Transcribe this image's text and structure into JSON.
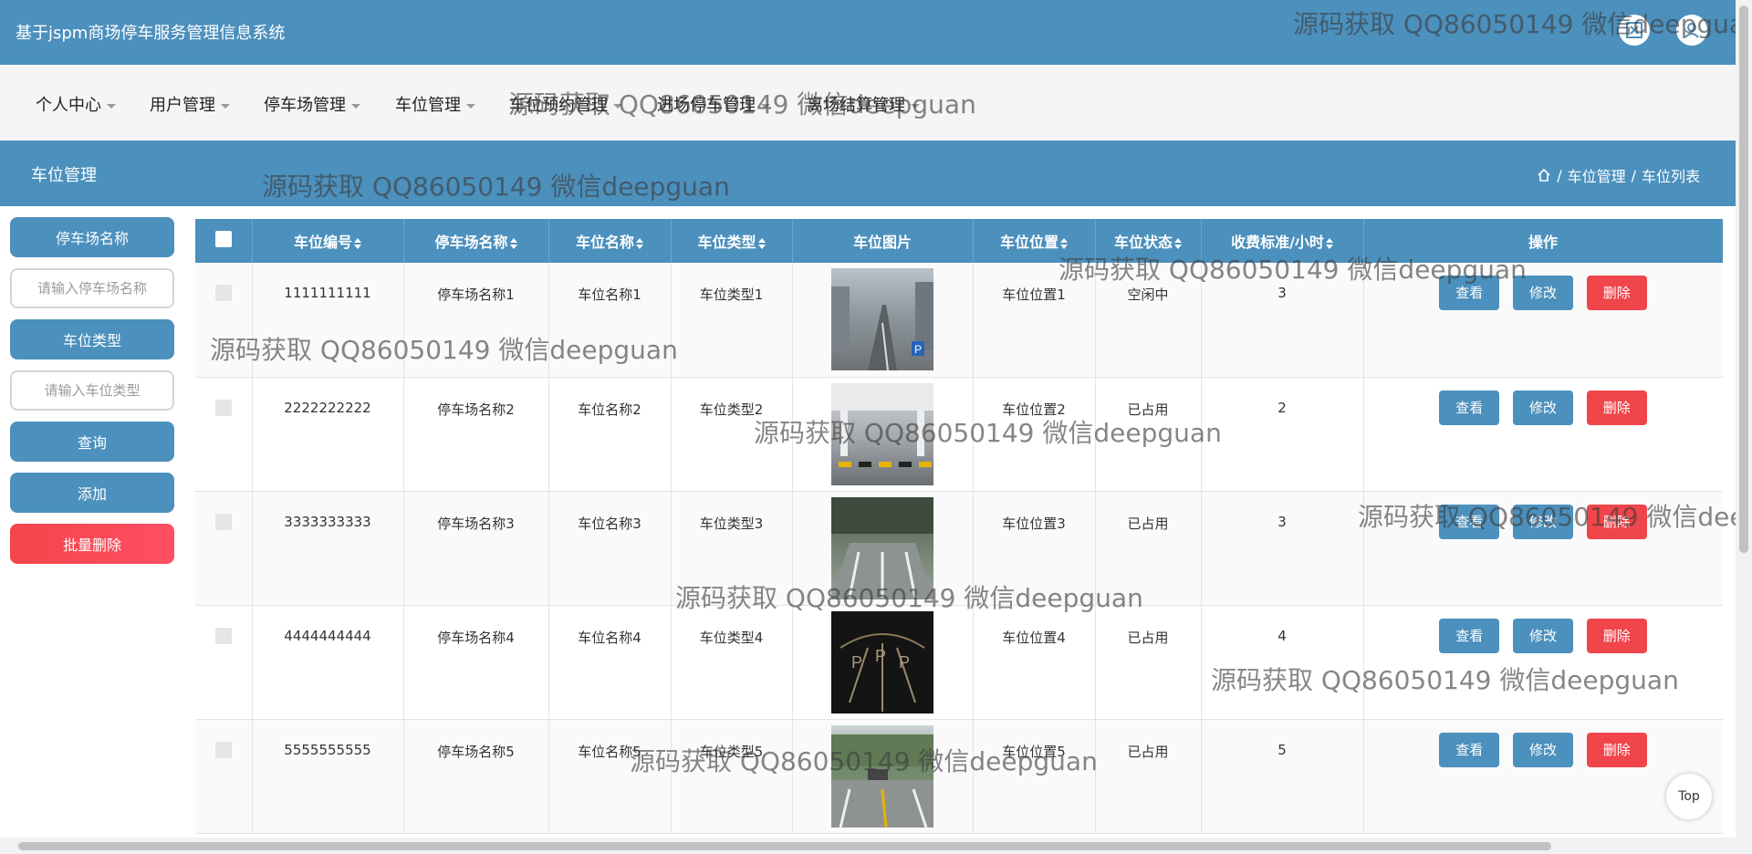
{
  "app": {
    "title": "基于jspm商场停车服务管理信息系统"
  },
  "nav": [
    {
      "label": "个人中心"
    },
    {
      "label": "用户管理"
    },
    {
      "label": "停车场管理"
    },
    {
      "label": "车位管理"
    },
    {
      "label": "车位预约管理"
    },
    {
      "label": "进场停车管理"
    },
    {
      "label": "离场结算管理"
    }
  ],
  "page": {
    "title": "车位管理",
    "breadcrumb": [
      "车位管理",
      "车位列表"
    ]
  },
  "sidebar": {
    "lot_name_label": "停车场名称",
    "lot_name_placeholder": "请输入停车场名称",
    "space_type_label": "车位类型",
    "space_type_placeholder": "请输入车位类型",
    "query": "查询",
    "add": "添加",
    "batch_delete": "批量删除"
  },
  "table": {
    "columns": [
      "车位编号",
      "停车场名称",
      "车位名称",
      "车位类型",
      "车位图片",
      "车位位置",
      "车位状态",
      "收费标准/小时",
      "操作"
    ],
    "rows": [
      {
        "id": "1111111111",
        "lot": "停车场名称1",
        "name": "车位名称1",
        "type": "车位类型1",
        "pos": "车位位置1",
        "status": "空闲中",
        "fee": "3"
      },
      {
        "id": "2222222222",
        "lot": "停车场名称2",
        "name": "车位名称2",
        "type": "车位类型2",
        "pos": "车位位置2",
        "status": "已占用",
        "fee": "2"
      },
      {
        "id": "3333333333",
        "lot": "停车场名称3",
        "name": "车位名称3",
        "type": "车位类型3",
        "pos": "车位位置3",
        "status": "已占用",
        "fee": "3"
      },
      {
        "id": "4444444444",
        "lot": "停车场名称4",
        "name": "车位名称4",
        "type": "车位类型4",
        "pos": "车位位置4",
        "status": "已占用",
        "fee": "4"
      },
      {
        "id": "5555555555",
        "lot": "停车场名称5",
        "name": "车位名称5",
        "type": "车位类型5",
        "pos": "车位位置5",
        "status": "已占用",
        "fee": "5"
      }
    ],
    "actions": {
      "view": "查看",
      "edit": "修改",
      "delete": "删除"
    }
  },
  "watermark": "源码获取 QQ86050149 微信deepguan",
  "top_button": "Top",
  "colors": {
    "primary": "#4c90bd",
    "danger": "#f0454a"
  },
  "icons": [
    "close-icon",
    "user-icon",
    "home-icon",
    "sort-icon",
    "checkbox-icon"
  ]
}
